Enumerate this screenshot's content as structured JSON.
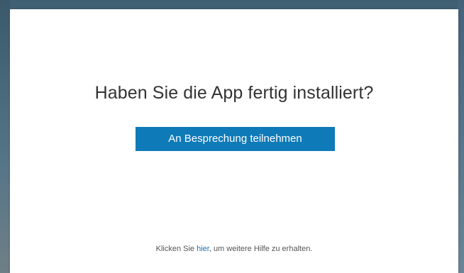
{
  "dialog": {
    "title": "Haben Sie die App fertig installiert?",
    "join_button_label": "An Besprechung teilnehmen",
    "help": {
      "prefix": "Klicken Sie ",
      "link_text": "hier",
      "suffix": ", um weitere Hilfe zu erhalten."
    }
  },
  "colors": {
    "button_background": "#0f7ab8",
    "link": "#1a6fb0"
  }
}
